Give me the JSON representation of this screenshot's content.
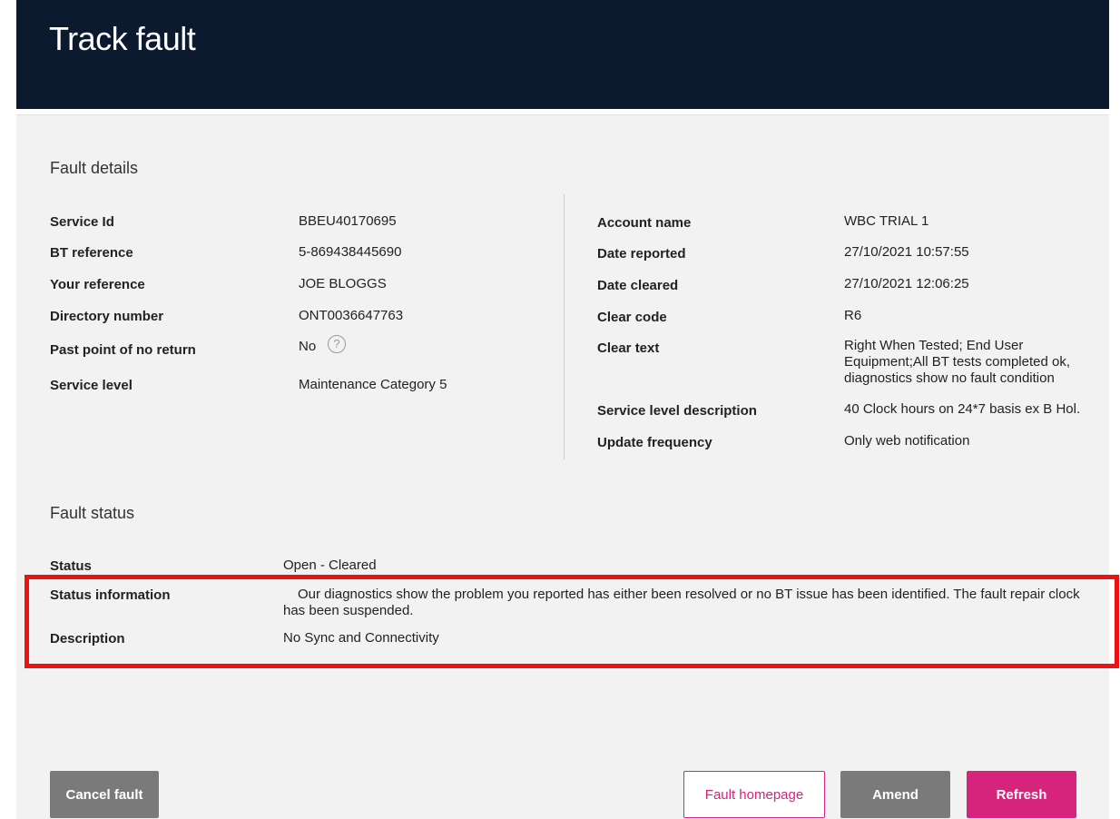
{
  "header": {
    "title": "Track fault"
  },
  "fault_details": {
    "section_title": "Fault details",
    "left": [
      {
        "label": "Service Id",
        "value": "BBEU40170695"
      },
      {
        "label": "BT reference",
        "value": "5-869438445690"
      },
      {
        "label": "Your reference",
        "value": "JOE BLOGGS"
      },
      {
        "label": "Directory number",
        "value": "ONT0036647763"
      },
      {
        "label": "Past point of no return",
        "value": "No",
        "icon": "help-icon"
      },
      {
        "label": "Service level",
        "value": "Maintenance Category 5"
      }
    ],
    "right": [
      {
        "label": "Account name",
        "value": "WBC TRIAL 1"
      },
      {
        "label": "Date reported",
        "value": "27/10/2021 10:57:55"
      },
      {
        "label": "Date cleared",
        "value": "27/10/2021 12:06:25"
      },
      {
        "label": "Clear code",
        "value": "R6"
      },
      {
        "label": "Clear text",
        "value": "Right When Tested; End User Equipment;All BT tests completed ok, diagnostics show no fault condition"
      },
      {
        "label": "Service level description",
        "value": "40 Clock hours on 24*7 basis ex B Hol."
      },
      {
        "label": "Update frequency",
        "value": "Only web notification"
      }
    ]
  },
  "fault_status": {
    "section_title": "Fault status",
    "rows": [
      {
        "label": "Status",
        "value": "Open - Cleared"
      },
      {
        "label": "Status information",
        "value": "Our diagnostics show the problem you reported has either been resolved or no BT issue has been identified. The fault repair clock has been suspended."
      },
      {
        "label": "Description",
        "value": "No Sync and Connectivity"
      }
    ]
  },
  "actions": {
    "cancel_label": "Cancel fault",
    "home_label": "Fault homepage",
    "amend_label": "Amend",
    "refresh_label": "Refresh"
  },
  "colors": {
    "header_bg": "#0b1a2e",
    "accent": "#d6237b",
    "highlight": "#ee1111"
  }
}
